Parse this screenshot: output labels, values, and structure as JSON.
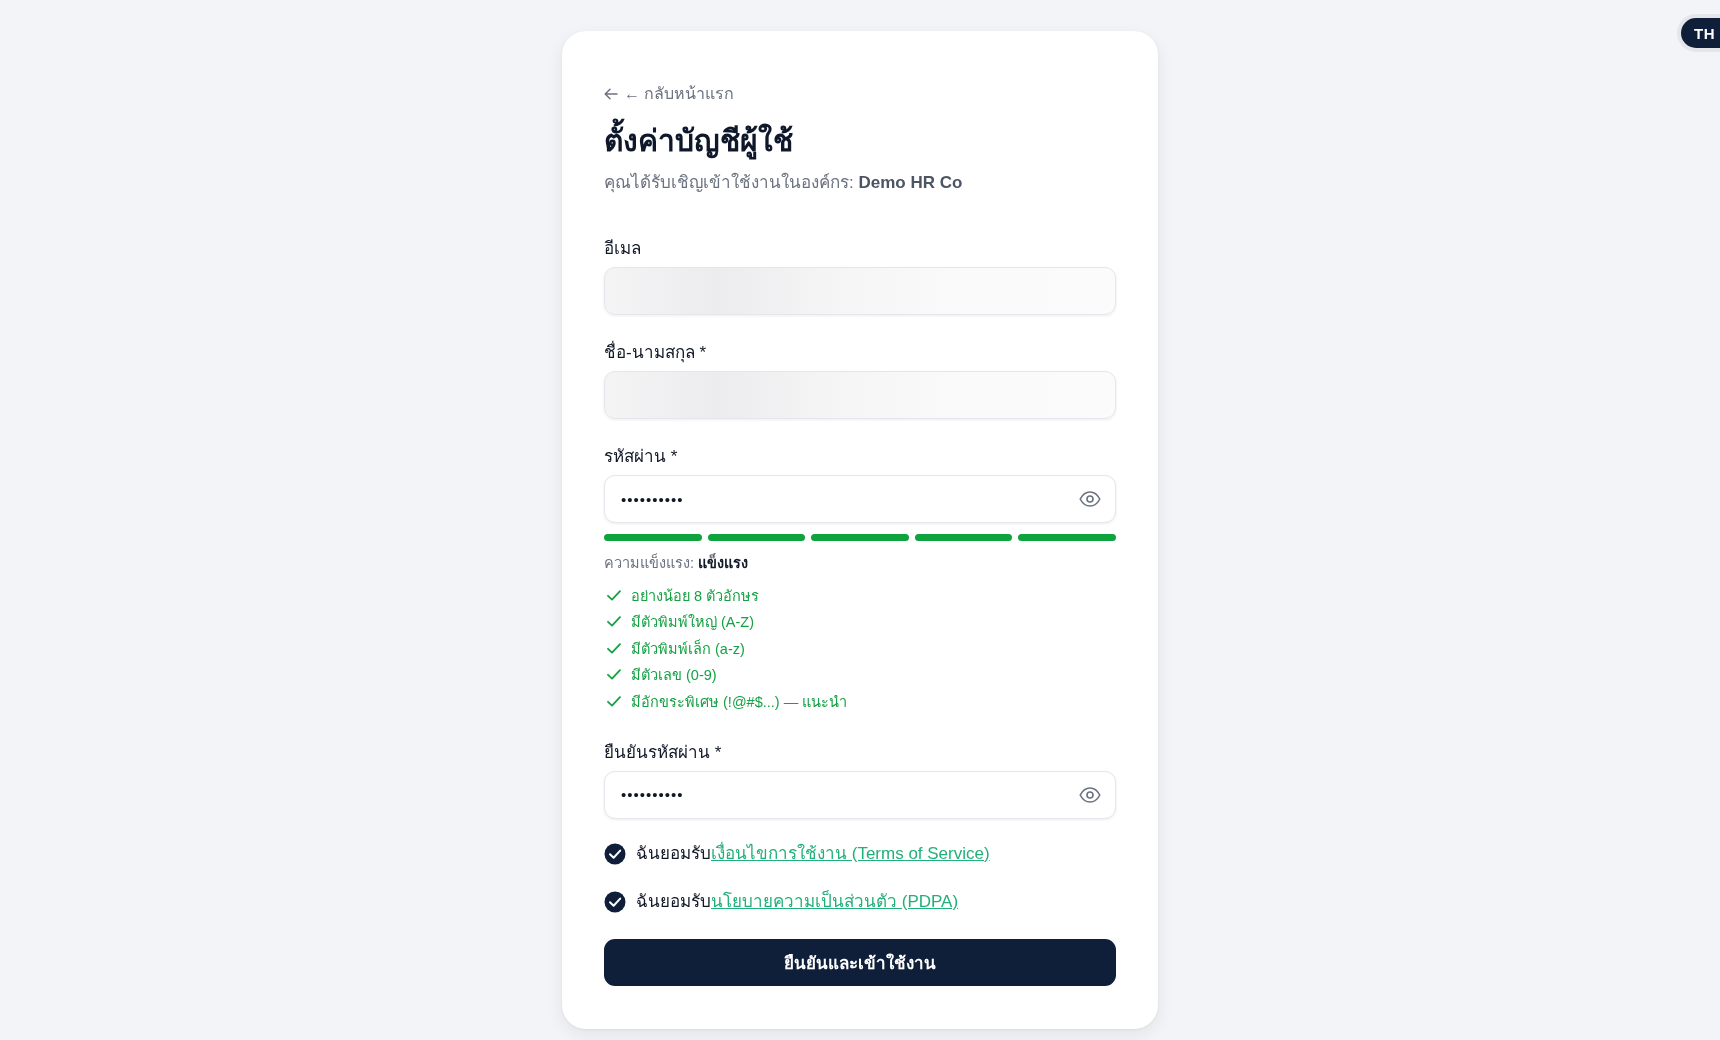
{
  "language_button": {
    "label": "TH"
  },
  "back_link": {
    "label": "← กลับหน้าแรก"
  },
  "title": "ตั้งค่าบัญชีผู้ใช้",
  "subtitle": "คุณได้รับเชิญเข้าใช้งานในองค์กร: **Demo HR Co**",
  "fields": [
    {
      "kind": "text",
      "label": "อีเมล",
      "redacted": true
    },
    {
      "kind": "text",
      "label": "ชื่อ-นามสกุล *",
      "redacted": true
    },
    {
      "kind": "password",
      "label": "รหัสผ่าน *",
      "value": "••••••••••",
      "strength": {
        "segments": [
          {
            "filled": true
          },
          {
            "filled": true
          },
          {
            "filled": true
          },
          {
            "filled": true
          },
          {
            "filled": true
          }
        ],
        "label": "ความแข็งแรง: **แข็งแรง**",
        "requirements": [
          {
            "text": "อย่างน้อย 8 ตัวอักษร",
            "met": true
          },
          {
            "text": "มีตัวพิมพ์ใหญ่ (A-Z)",
            "met": true
          },
          {
            "text": "มีตัวพิมพ์เล็ก (a-z)",
            "met": true
          },
          {
            "text": "มีตัวเลข (0-9)",
            "met": true
          },
          {
            "text": "มีอักขระพิเศษ (!@#$...) — แนะนำ",
            "met": true
          }
        ]
      }
    },
    {
      "kind": "password",
      "label": "ยืนยันรหัสผ่าน *",
      "value": "••••••••••"
    }
  ],
  "agreements": [
    {
      "checked": true,
      "text": "ฉันยอมรับ",
      "link": "เงื่อนไขการใช้งาน (Terms of Service)"
    },
    {
      "checked": true,
      "text": "ฉันยอมรับ",
      "link": "นโยบายความเป็นส่วนตัว (PDPA)"
    }
  ],
  "submit_button": {
    "label": "ยืนยันและเข้าใช้งาน"
  }
}
